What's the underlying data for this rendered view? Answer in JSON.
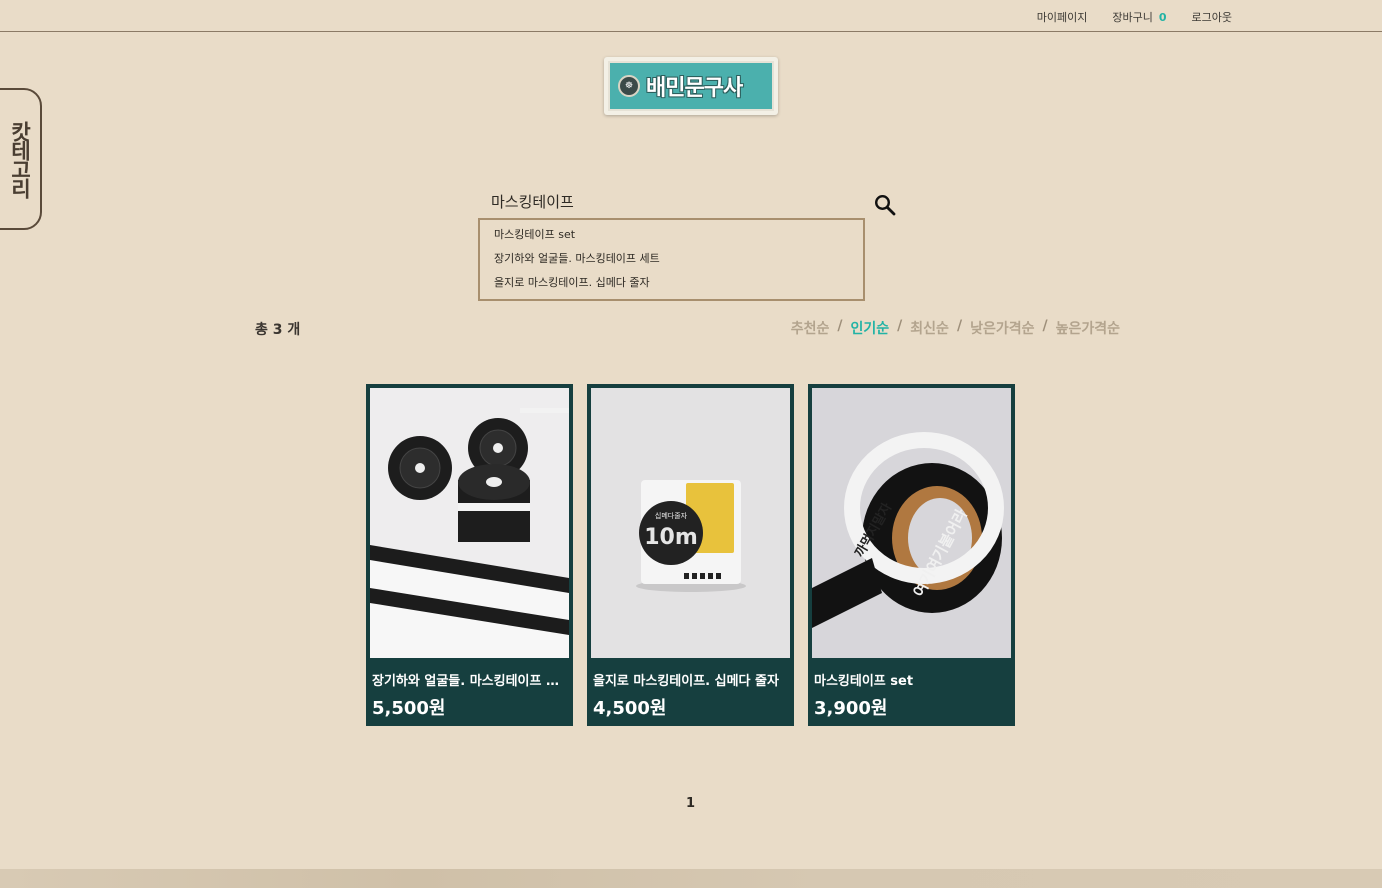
{
  "topbar": {
    "mypage": "마이페이지",
    "cart_label": "장바구니",
    "cart_count": "0",
    "logout": "로그아웃"
  },
  "category_tab": {
    "label": "캇테고리"
  },
  "logo": {
    "text": "배민문구사",
    "icon": "emblem-icon"
  },
  "search": {
    "value": "마스킹테이프",
    "icon": "search-icon",
    "suggestions": [
      "마스킹테이프 set",
      "장기하와 얼굴들. 마스킹테이프 세트",
      "을지로 마스킹테이프. 십메다 줄자"
    ]
  },
  "results": {
    "total_label": "총 3 개"
  },
  "sort": {
    "options": [
      "추천순",
      "인기순",
      "최신순",
      "낮은가격순",
      "높은가격순"
    ],
    "active": "인기순",
    "separator": "/"
  },
  "products": [
    {
      "name": "장기하와 얼굴들. 마스킹테이프 세트",
      "price": "5,500원"
    },
    {
      "name": "을지로 마스킹테이프. 십메다 줄자",
      "price": "4,500원"
    },
    {
      "name": "마스킹테이프 set",
      "price": "3,900원"
    }
  ],
  "product_images": {
    "p2_label_top": "십메다줄자",
    "p2_label_big": "10m",
    "p3_text_a": "여기여기붙어라",
    "p3_text_b": "까먹지말자"
  },
  "pagination": {
    "current": "1"
  },
  "colors": {
    "accent": "#22b3a5",
    "card_bg": "#163f3f",
    "page_bg": "#e9dcc8"
  }
}
